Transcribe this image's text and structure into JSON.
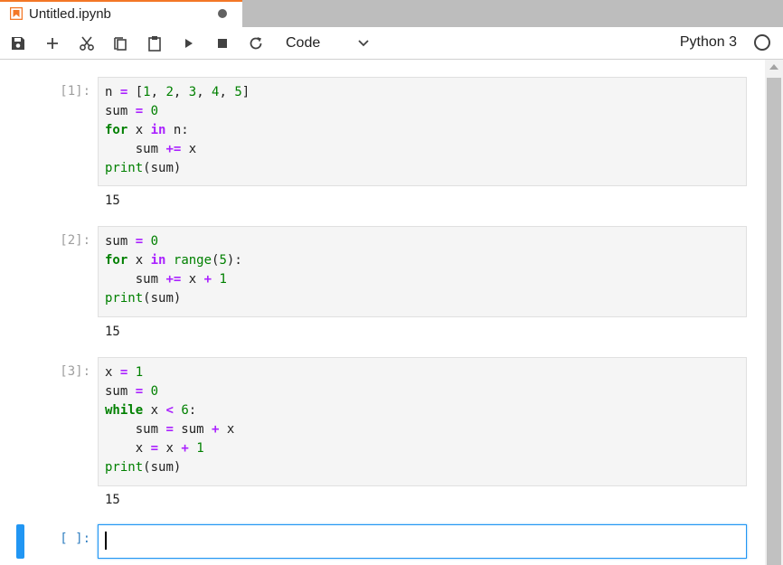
{
  "tab": {
    "title": "Untitled.ipynb"
  },
  "toolbar": {
    "cell_type": "Code",
    "kernel_name": "Python 3",
    "icons": [
      "save-icon",
      "add-icon",
      "cut-icon",
      "copy-icon",
      "paste-icon",
      "run-icon",
      "stop-icon",
      "restart-icon",
      "chevron-down-icon",
      "kernel-idle-icon"
    ]
  },
  "colors": {
    "accent": "#f37726",
    "active": "#2196f3",
    "keyword": "#008000",
    "operator": "#aa22ff"
  },
  "cells": [
    {
      "prompt": "[1]:",
      "lines": [
        [
          [
            "n ",
            ""
          ],
          [
            "=",
            "op"
          ],
          [
            " [",
            ""
          ],
          [
            "1",
            "num"
          ],
          [
            ", ",
            ""
          ],
          [
            "2",
            "num"
          ],
          [
            ", ",
            ""
          ],
          [
            "3",
            "num"
          ],
          [
            ", ",
            ""
          ],
          [
            "4",
            "num"
          ],
          [
            ", ",
            ""
          ],
          [
            "5",
            "num"
          ],
          [
            "]",
            ""
          ]
        ],
        [
          [
            "sum ",
            ""
          ],
          [
            "=",
            "op"
          ],
          [
            " ",
            ""
          ],
          [
            "0",
            "num"
          ]
        ],
        [
          [
            "for",
            "kw"
          ],
          [
            " x ",
            ""
          ],
          [
            "in",
            "op"
          ],
          [
            " n:",
            ""
          ]
        ],
        [
          [
            "    sum ",
            ""
          ],
          [
            "+=",
            "op"
          ],
          [
            " x",
            ""
          ]
        ],
        [
          [
            "print",
            "bi"
          ],
          [
            "(sum)",
            ""
          ]
        ]
      ],
      "output": "15"
    },
    {
      "prompt": "[2]:",
      "lines": [
        [
          [
            "sum ",
            ""
          ],
          [
            "=",
            "op"
          ],
          [
            " ",
            ""
          ],
          [
            "0",
            "num"
          ]
        ],
        [
          [
            "for",
            "kw"
          ],
          [
            " x ",
            ""
          ],
          [
            "in",
            "op"
          ],
          [
            " ",
            ""
          ],
          [
            "range",
            "bi"
          ],
          [
            "(",
            ""
          ],
          [
            "5",
            "num"
          ],
          [
            "):",
            ""
          ]
        ],
        [
          [
            "    sum ",
            ""
          ],
          [
            "+=",
            "op"
          ],
          [
            " x ",
            ""
          ],
          [
            "+",
            "op"
          ],
          [
            " ",
            ""
          ],
          [
            "1",
            "num"
          ]
        ],
        [
          [
            "print",
            "bi"
          ],
          [
            "(sum)",
            ""
          ]
        ]
      ],
      "output": "15"
    },
    {
      "prompt": "[3]:",
      "lines": [
        [
          [
            "x ",
            ""
          ],
          [
            "=",
            "op"
          ],
          [
            " ",
            ""
          ],
          [
            "1",
            "num"
          ]
        ],
        [
          [
            "sum ",
            ""
          ],
          [
            "=",
            "op"
          ],
          [
            " ",
            ""
          ],
          [
            "0",
            "num"
          ]
        ],
        [
          [
            "while",
            "kw"
          ],
          [
            " x ",
            ""
          ],
          [
            "<",
            "op"
          ],
          [
            " ",
            ""
          ],
          [
            "6",
            "num"
          ],
          [
            ":",
            ""
          ]
        ],
        [
          [
            "    sum ",
            ""
          ],
          [
            "=",
            "op"
          ],
          [
            " sum ",
            ""
          ],
          [
            "+",
            "op"
          ],
          [
            " x",
            ""
          ]
        ],
        [
          [
            "    x ",
            ""
          ],
          [
            "=",
            "op"
          ],
          [
            " x ",
            ""
          ],
          [
            "+",
            "op"
          ],
          [
            " ",
            ""
          ],
          [
            "1",
            "num"
          ]
        ],
        [
          [
            "print",
            "bi"
          ],
          [
            "(sum)",
            ""
          ]
        ]
      ],
      "output": "15"
    }
  ],
  "active_cell": {
    "prompt": "[ ]:",
    "value": ""
  }
}
